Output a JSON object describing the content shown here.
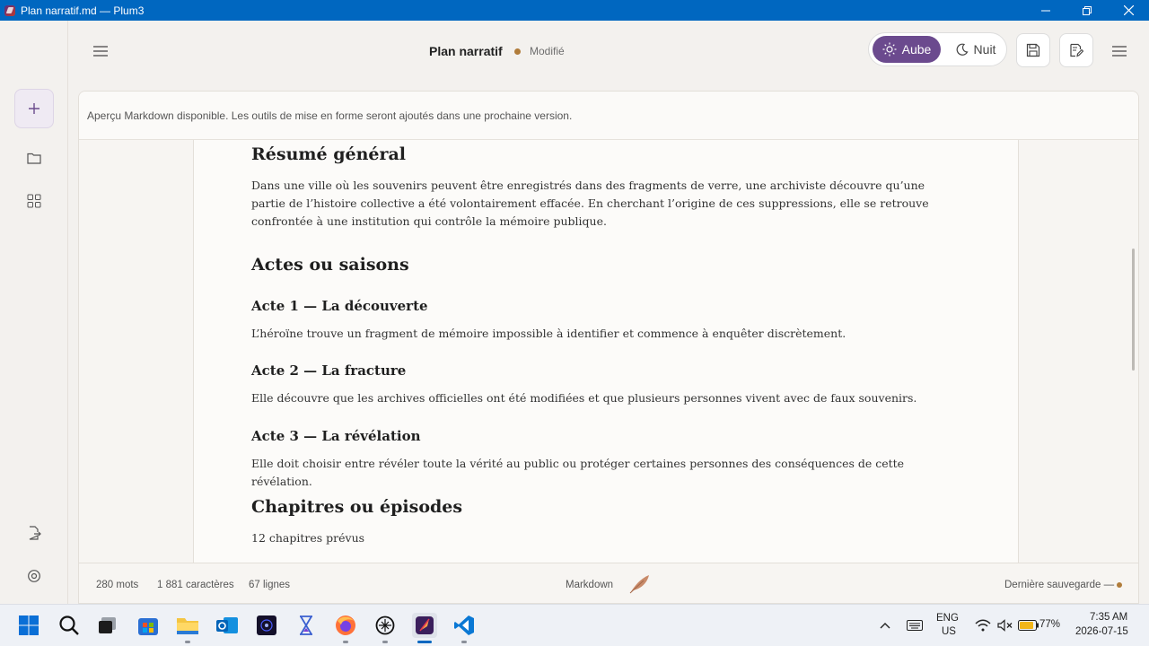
{
  "window": {
    "title": "Plan narratif.md — Plum3"
  },
  "header": {
    "doc_title": "Plan narratif",
    "status": "Modifié",
    "theme_light": "Aube",
    "theme_dark": "Nuit"
  },
  "notice": "Aperçu Markdown disponible. Les outils de mise en forme seront ajoutés dans une prochaine version.",
  "document": {
    "h_summary": "Résumé général",
    "summary": "Dans une ville où les souvenirs peuvent être enregistrés dans des fragments de verre, une archiviste découvre qu’une partie de l’histoire collective a été volontairement effacée. En cherchant l’origine de ces suppressions, elle se retrouve confrontée à une institution qui contrôle la mémoire publique.",
    "h_acts": "Actes ou saisons",
    "acts": [
      {
        "title": "Acte 1 — La découverte",
        "text": "L’héroïne trouve un fragment de mémoire impossible à identifier et commence à enquêter discrètement."
      },
      {
        "title": "Acte 2 — La fracture",
        "text": "Elle découvre que les archives officielles ont été modifiées et que plusieurs personnes vivent avec de faux souvenirs."
      },
      {
        "title": "Acte 3 — La révélation",
        "text": "Elle doit choisir entre révéler toute la vérité au public ou protéger certaines personnes des conséquences de cette révélation."
      }
    ],
    "h_chapters": "Chapitres ou épisodes",
    "chapters": "12 chapitres prévus"
  },
  "statusbar": {
    "words": "280 mots",
    "chars": "1 881 caractères",
    "lines": "67 lignes",
    "mode": "Markdown",
    "last_save": "Dernière sauvegarde —"
  },
  "taskbar": {
    "lang": "ENG",
    "region": "US",
    "battery": "77%",
    "time": "7:35 AM",
    "date": "2026-07-15"
  },
  "colors": {
    "accent": "#6b4a8e",
    "titlebar": "#0067c0",
    "status_dot": "#b07c3a"
  }
}
